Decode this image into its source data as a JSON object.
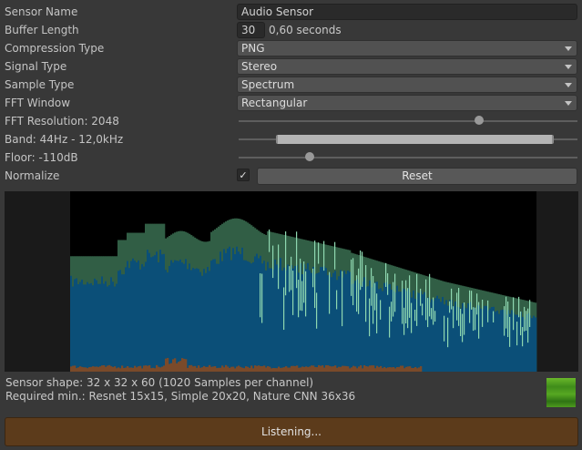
{
  "fields": {
    "sensor_name": {
      "label": "Sensor Name",
      "value": "Audio Sensor"
    },
    "buffer_length": {
      "label": "Buffer Length",
      "value": "30",
      "suffix": "0,60 seconds"
    },
    "compression_type": {
      "label": "Compression Type",
      "value": "PNG"
    },
    "signal_type": {
      "label": "Signal Type",
      "value": "Stereo"
    },
    "sample_type": {
      "label": "Sample Type",
      "value": "Spectrum"
    },
    "fft_window": {
      "label": "FFT Window",
      "value": "Rectangular"
    },
    "fft_resolution": {
      "label": "FFT Resolution: 2048",
      "slider_fraction": 0.71
    },
    "band": {
      "label": "Band: 44Hz - 12,0kHz",
      "range_start_fraction": 0.11,
      "range_end_fraction": 0.93
    },
    "floor": {
      "label": "Floor: -110dB",
      "slider_fraction": 0.21
    },
    "normalize": {
      "label": "Normalize",
      "checked": true,
      "check_glyph": "✓"
    }
  },
  "buttons": {
    "reset_label": "Reset",
    "listening_label": "Listening..."
  },
  "info": {
    "sensor_shape": "Sensor shape: 32 x 32 x 60 (1020 Samples per channel)",
    "required_min": "Required min.: Resnet 15x15, Simple 20x20, Nature CNN 36x36"
  },
  "icons": {
    "dropdown": "chevron-down-icon",
    "preview": "spectrogram-thumbnail-icon"
  },
  "colors": {
    "spectrum_fill": "#0b4f78",
    "spectrum_secondary": "#315e45",
    "spectrum_peaks": "#8ed7b0",
    "orange_channel": "#7a4a2a",
    "listening_bg": "#5c3b1b"
  }
}
